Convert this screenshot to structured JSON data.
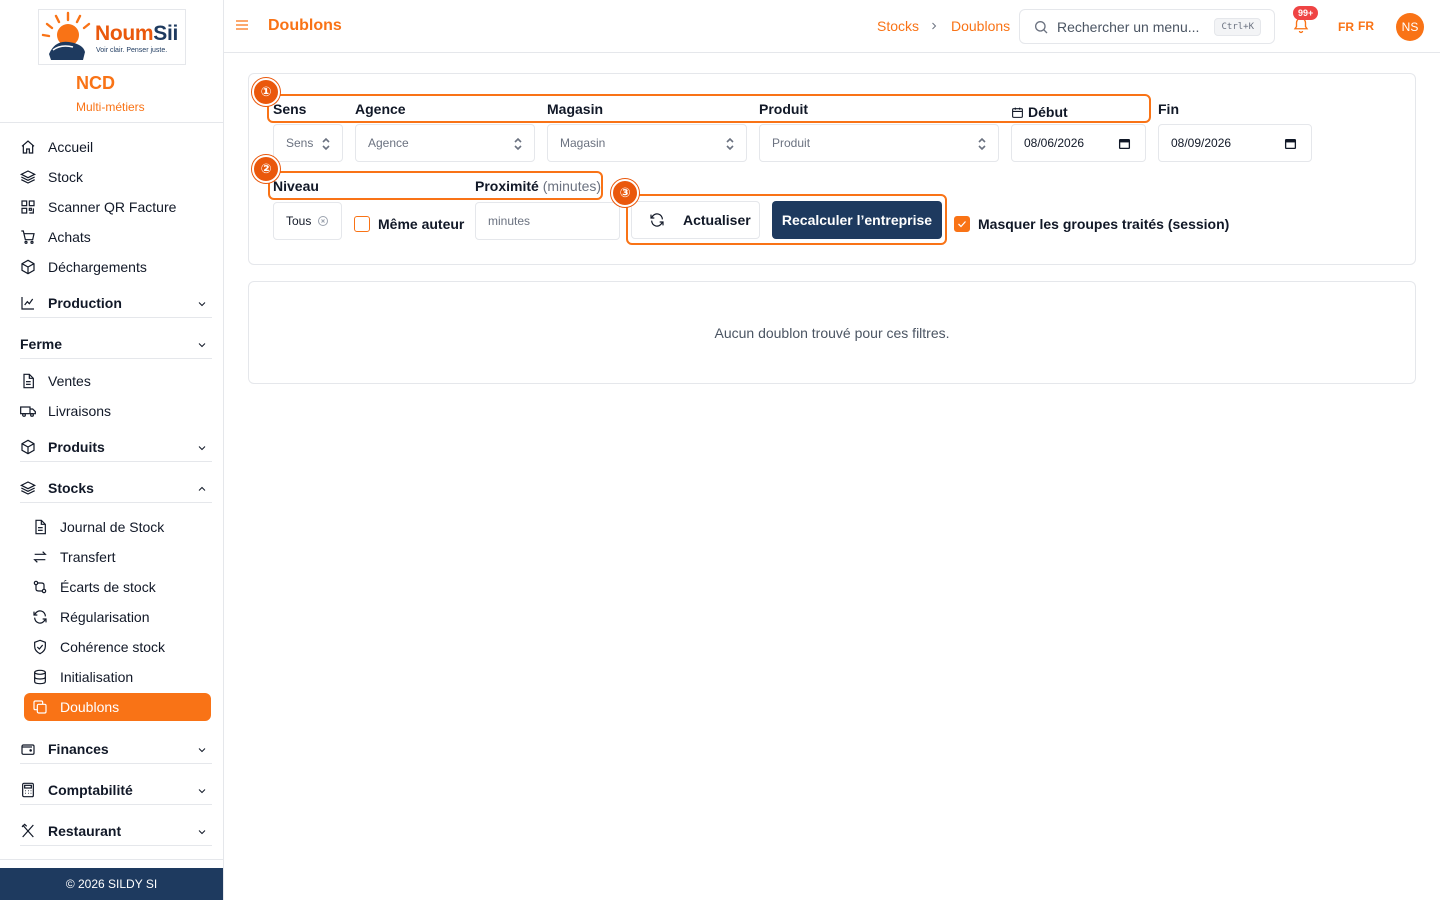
{
  "brand": {
    "logo_main": "Noum",
    "logo_accent": "Sii",
    "tagline": "Voir clair. Penser juste.",
    "org_name": "NCD",
    "org_subtitle": "Multi-métiers",
    "accent_color": "#f97316",
    "navy_color": "#1e3a5f"
  },
  "sidebar": {
    "items": [
      {
        "label": "Accueil",
        "icon": "home-icon"
      },
      {
        "label": "Stock",
        "icon": "layers-icon"
      },
      {
        "label": "Scanner QR Facture",
        "icon": "qr-icon"
      },
      {
        "label": "Achats",
        "icon": "cart-icon"
      },
      {
        "label": "Déchargements",
        "icon": "package-icon"
      }
    ],
    "groups": {
      "production": "Production",
      "ferme": "Ferme",
      "produits": "Produits",
      "stocks": "Stocks",
      "finances": "Finances",
      "comptabilite": "Comptabilité",
      "restaurant": "Restaurant"
    },
    "ferme_items": [
      {
        "label": "Ventes",
        "icon": "file-icon"
      },
      {
        "label": "Livraisons",
        "icon": "truck-icon"
      }
    ],
    "stocks_items": [
      {
        "label": "Journal de Stock",
        "icon": "file-text-icon"
      },
      {
        "label": "Transfert",
        "icon": "transfer-icon"
      },
      {
        "label": "Écarts de stock",
        "icon": "git-compare-icon"
      },
      {
        "label": "Régularisation",
        "icon": "refresh-icon"
      },
      {
        "label": "Cohérence stock",
        "icon": "shield-check-icon"
      },
      {
        "label": "Initialisation",
        "icon": "database-icon"
      },
      {
        "label": "Doublons",
        "icon": "copy-icon",
        "active": true
      }
    ],
    "footer": "© 2026 SILDY SI"
  },
  "topbar": {
    "title": "Doublons",
    "breadcrumb": [
      "Stocks",
      "Doublons"
    ],
    "search_placeholder": "Rechercher un menu...",
    "search_shortcut": "Ctrl+K",
    "notif_badge": "99+",
    "lang_1": "FR",
    "lang_2": "FR",
    "avatar": "NS"
  },
  "filters": {
    "labels": {
      "sens": "Sens",
      "agence": "Agence",
      "magasin": "Magasin",
      "produit": "Produit",
      "debut": "Début",
      "fin": "Fin",
      "niveau": "Niveau",
      "proximite": "Proximité",
      "proximite_unit": "(minutes)"
    },
    "placeholders": {
      "sens": "Sens",
      "agence": "Agence",
      "magasin": "Magasin",
      "produit": "Produit",
      "minutes": "minutes"
    },
    "debut_value": "08/06/2026",
    "fin_value": "08/09/2026",
    "niveau_value": "Tous",
    "meme_auteur_label": "Même auteur",
    "meme_auteur_checked": false,
    "btn_actualiser": "Actualiser",
    "btn_recalculer": "Recalculer l’entreprise",
    "masquer_label": "Masquer les groupes traités (session)",
    "masquer_checked": true
  },
  "annotations": [
    "①",
    "②",
    "③"
  ],
  "results": {
    "empty_message": "Aucun doublon trouvé pour ces filtres."
  }
}
